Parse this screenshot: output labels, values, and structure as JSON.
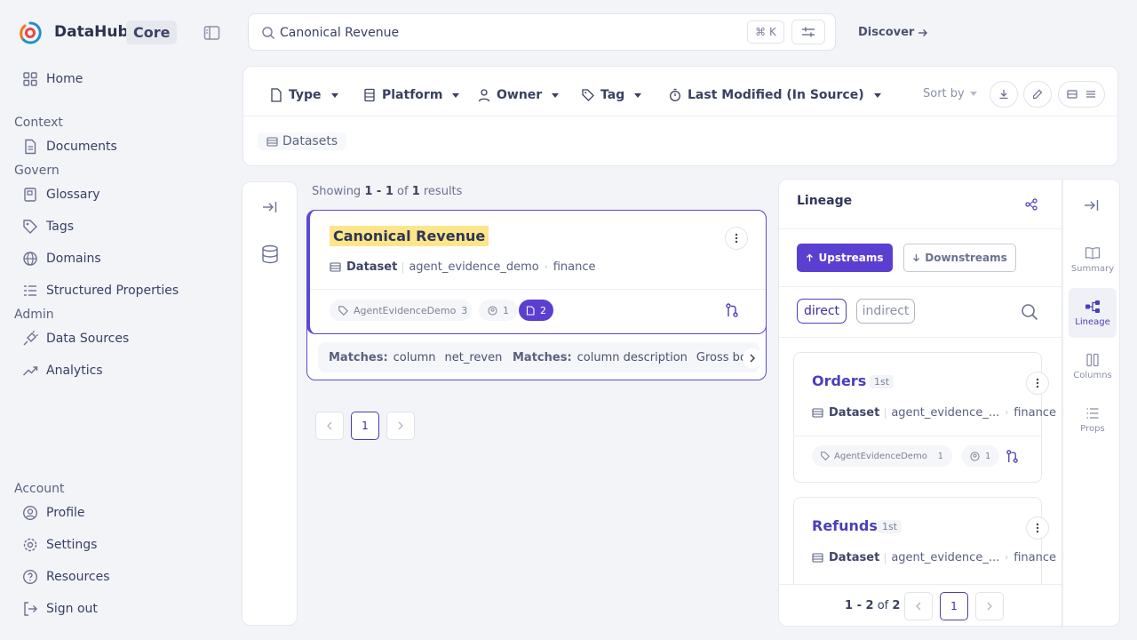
{
  "brand": {
    "name": "DataHub",
    "badge": "Core"
  },
  "sidebar": {
    "home": "Home",
    "sections": {
      "context": "Context",
      "govern": "Govern",
      "admin": "Admin",
      "account": "Account"
    },
    "context_items": [
      "Documents"
    ],
    "govern_items": [
      "Glossary",
      "Tags",
      "Domains",
      "Structured Properties"
    ],
    "admin_items": [
      "Data Sources",
      "Analytics"
    ],
    "account_items": [
      "Profile",
      "Settings",
      "Resources",
      "Sign out"
    ]
  },
  "search": {
    "value": "Canonical Revenue",
    "shortcut": "⌘ K"
  },
  "discover": "Discover",
  "filters": {
    "items": [
      "Type",
      "Platform",
      "Owner",
      "Tag",
      "Last Modified (In Source)"
    ],
    "sort_label": "Sort by",
    "active_chip": "Datasets"
  },
  "results": {
    "showing_prefix": "Showing",
    "range": "1 - 1",
    "of": "of",
    "total": "1",
    "suffix": "results"
  },
  "result_card": {
    "title": "Canonical Revenue",
    "type": "Dataset",
    "container": "agent_evidence_demo",
    "domain": "finance",
    "tag": "AgentEvidenceDemo",
    "tag_count": "3",
    "owners_count": "1",
    "docs_count": "2",
    "matches": [
      {
        "label": "Matches:",
        "field": "column",
        "value": "net_revenue"
      },
      {
        "label": "Matches:",
        "field": "column description",
        "value": "Gross booked re"
      }
    ]
  },
  "pagination": {
    "current": "1"
  },
  "lineage": {
    "title": "Lineage",
    "upstreams": "Upstreams",
    "downstreams": "Downstreams",
    "direct": "direct",
    "indirect": "indirect",
    "cards": [
      {
        "name": "Orders",
        "degree": "1st",
        "type": "Dataset",
        "container": "agent_evidence_...",
        "domain": "finance",
        "tag": "AgentEvidenceDemo",
        "tag_count": "1",
        "owners_count": "1"
      },
      {
        "name": "Refunds",
        "degree": "1st",
        "type": "Dataset",
        "container": "agent_evidence_...",
        "domain": "finance"
      }
    ],
    "pager": {
      "range": "1 - 2",
      "of": "of",
      "total": "2",
      "current": "1"
    }
  },
  "side_tabs": [
    "Summary",
    "Lineage",
    "Columns",
    "Props"
  ],
  "colors": {
    "accent": "#5b3fd0",
    "highlight": "#fde58a",
    "background": "#f3f4f8"
  }
}
